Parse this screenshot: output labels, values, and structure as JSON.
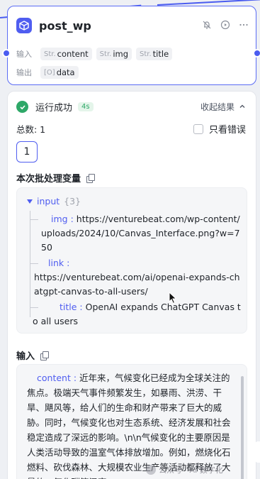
{
  "node": {
    "title": "post_wp",
    "input_label": "输入",
    "output_label": "输出",
    "inputs": [
      {
        "type": "Str.",
        "name": "content"
      },
      {
        "type": "Str.",
        "name": "img"
      },
      {
        "type": "Str.",
        "name": "title"
      }
    ],
    "outputs": [
      {
        "type": "[O]",
        "name": "data"
      }
    ]
  },
  "result": {
    "status": "运行成功",
    "duration": "4s",
    "collapse_label": "收起结果",
    "total": "总数: 1",
    "only_errors": "只看错误",
    "page": "1"
  },
  "batch_vars": {
    "title": "本次批处理变量",
    "root_key": "input",
    "root_count": "{3}",
    "entries": [
      {
        "key": "img",
        "value": "https://venturebeat.com/wp-content/uploads/2024/10/Canvas_Interface.png?w=750"
      },
      {
        "key": "link",
        "value": "https://venturebeat.com/ai/openai-expands-chatgpt-canvas-to-all-users/"
      },
      {
        "key": "title",
        "value": "OpenAI expands ChatGPT Canvas to all users"
      }
    ]
  },
  "input_section": {
    "title": "输入",
    "key": "content",
    "value": "近年来，气候变化已经成为全球关注的焦点。极端天气事件频繁发生，如暴雨、洪涝、干旱、飓风等，给人们的生命和财产带来了巨大的威胁。同时，气候变化也对生态系统、经济发展和社会稳定造成了深远的影响。\\n\\n气候变化的主要原因是人类活动导致的温室气体排放增加。例如，燃烧化石燃料、砍伐森林、大规模农业生产等活动都释放了大量的二氧化碳等温室"
  },
  "watermark": "公众号 · AI 数字化",
  "colors": {
    "accent": "#4f5df0",
    "success": "#2ea868",
    "canvas": "#eef0f4"
  }
}
